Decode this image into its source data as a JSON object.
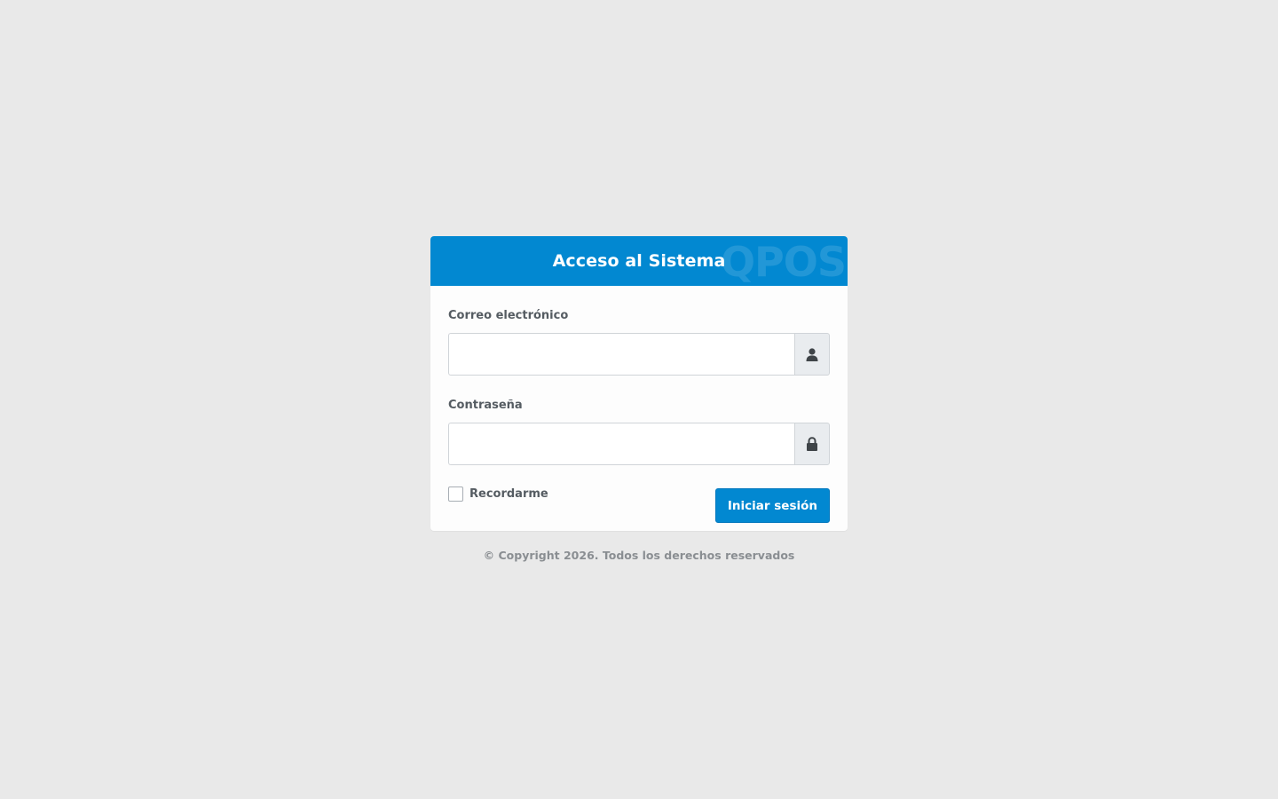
{
  "login": {
    "title": "Acceso al Sistema",
    "watermark": "QPOS",
    "email": {
      "label": "Correo electrónico",
      "value": "",
      "placeholder": "",
      "icon": "user-icon"
    },
    "password": {
      "label": "Contraseña",
      "value": "",
      "placeholder": "",
      "icon": "lock-icon"
    },
    "remember_label": "Recordarme",
    "remember_checked": false,
    "submit_label": "Iniciar sesión"
  },
  "footer": {
    "copyright": "© Copyright 2026. Todos los derechos reservados"
  },
  "colors": {
    "accent": "#0288d1",
    "background": "#e9e9e9",
    "card": "#fdfdfd"
  }
}
